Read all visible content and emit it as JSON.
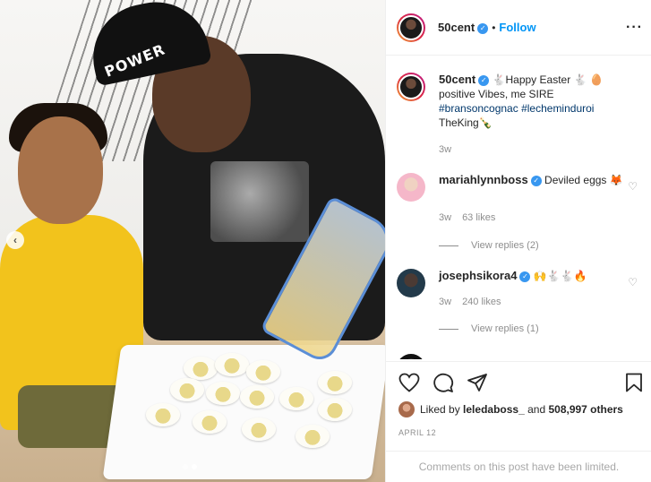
{
  "post": {
    "carousel_prev_label": "‹",
    "cap_text": "POWER"
  },
  "header": {
    "username": "50cent",
    "verified_glyph": "✓",
    "separator": "•",
    "follow_label": "Follow",
    "more_label": "···"
  },
  "caption": {
    "username": "50cent",
    "text_1": "🐇Happy Easter 🐇 🥚 positive Vibes, me SIRE ",
    "hashtag_1": "#bransoncognac",
    "hashtag_2": "#lecheminduroi",
    "text_2": " TheKing🍾",
    "time": "3w"
  },
  "comments": [
    {
      "username": "mariahlynnboss",
      "text": "Deviled eggs 🦊",
      "time": "3w",
      "likes": "63 likes",
      "view_replies": "View replies (2)"
    },
    {
      "username": "josephsikora4",
      "text": "🙌🐇🐇🔥",
      "time": "3w",
      "likes": "240 likes",
      "view_replies": "View replies (1)"
    }
  ],
  "actions": {
    "liked_by_prefix": "Liked by ",
    "liked_by_user": "leledaboss_",
    "liked_by_mid": " and ",
    "liked_by_count": "508,997 others",
    "date": "APRIL 12"
  },
  "footer": {
    "text": "Comments on this post have been limited."
  },
  "icons": {
    "heart": "heart-icon",
    "comment": "comment-icon",
    "share": "share-icon",
    "bookmark": "bookmark-icon"
  }
}
